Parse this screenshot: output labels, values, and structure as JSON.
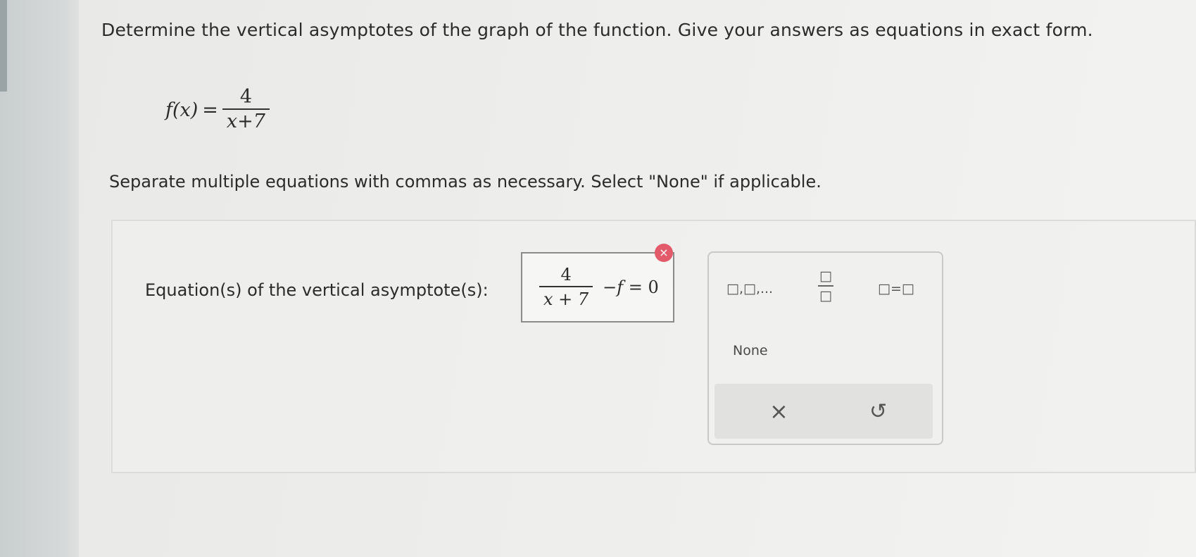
{
  "question": {
    "prompt": "Determine the vertical asymptotes of the graph of the function. Give your answers as equations in exact form.",
    "function_lhs": "f(x)",
    "equals": "=",
    "numerator": "4",
    "denominator": "x+7",
    "instructions": "Separate multiple equations with commas as necessary. Select \"None\" if applicable."
  },
  "answer": {
    "label": "Equation(s) of the vertical asymptote(s):",
    "numerator": "4",
    "denominator": "x + 7",
    "rest_minus": "−",
    "rest_f": "f",
    "rest_tail": " = 0",
    "error_icon": "×"
  },
  "palette": {
    "list_template": "□,□,...",
    "fraction_num": "□",
    "fraction_den": "□",
    "equation_template": "□=□",
    "none_label": "None",
    "clear_icon": "×",
    "undo_icon": "↺"
  }
}
